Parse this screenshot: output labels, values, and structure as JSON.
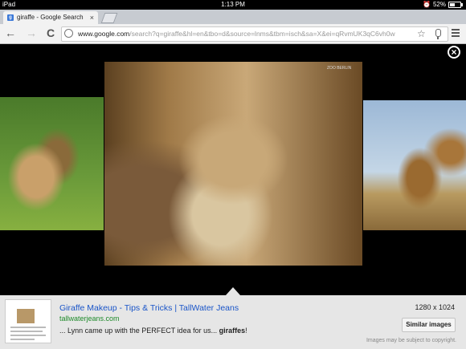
{
  "status_bar": {
    "device": "iPad",
    "time": "1:13 PM",
    "battery": "52%",
    "battery_level": 0.52
  },
  "tab": {
    "favicon": "g",
    "title": "giraffe - Google Search",
    "close": "×"
  },
  "toolbar": {
    "back": "←",
    "forward": "→",
    "reload": "C",
    "url_host": "www.google.com",
    "url_path": "/search?q=giraffe&hl=en&tbo=d&source=lnms&tbm=isch&sa=X&ei=qRvmUK3qC6vh0wHDjoGIAw&v"
  },
  "viewer": {
    "close": "×",
    "watermark": "ZOO BERLIN"
  },
  "result": {
    "title": "Giraffe Makeup - Tips & Tricks | TallWater Jeans",
    "site": "tallwaterjeans.com",
    "snippet_prefix": "... Lynn came up with the PERFECT idea for us... ",
    "snippet_bold": "giraffes",
    "snippet_suffix": "!",
    "dimensions": "1280 x 1024",
    "similar_label": "Similar images",
    "copyright": "Images may be subject to copyright."
  },
  "colors": {
    "link": "#1a55c8",
    "site": "#1e8a2a"
  },
  "icons": [
    "wifi-icon",
    "globe-icon",
    "star-icon",
    "mic-icon",
    "menu-icon",
    "close-icon",
    "alarm-icon"
  ]
}
